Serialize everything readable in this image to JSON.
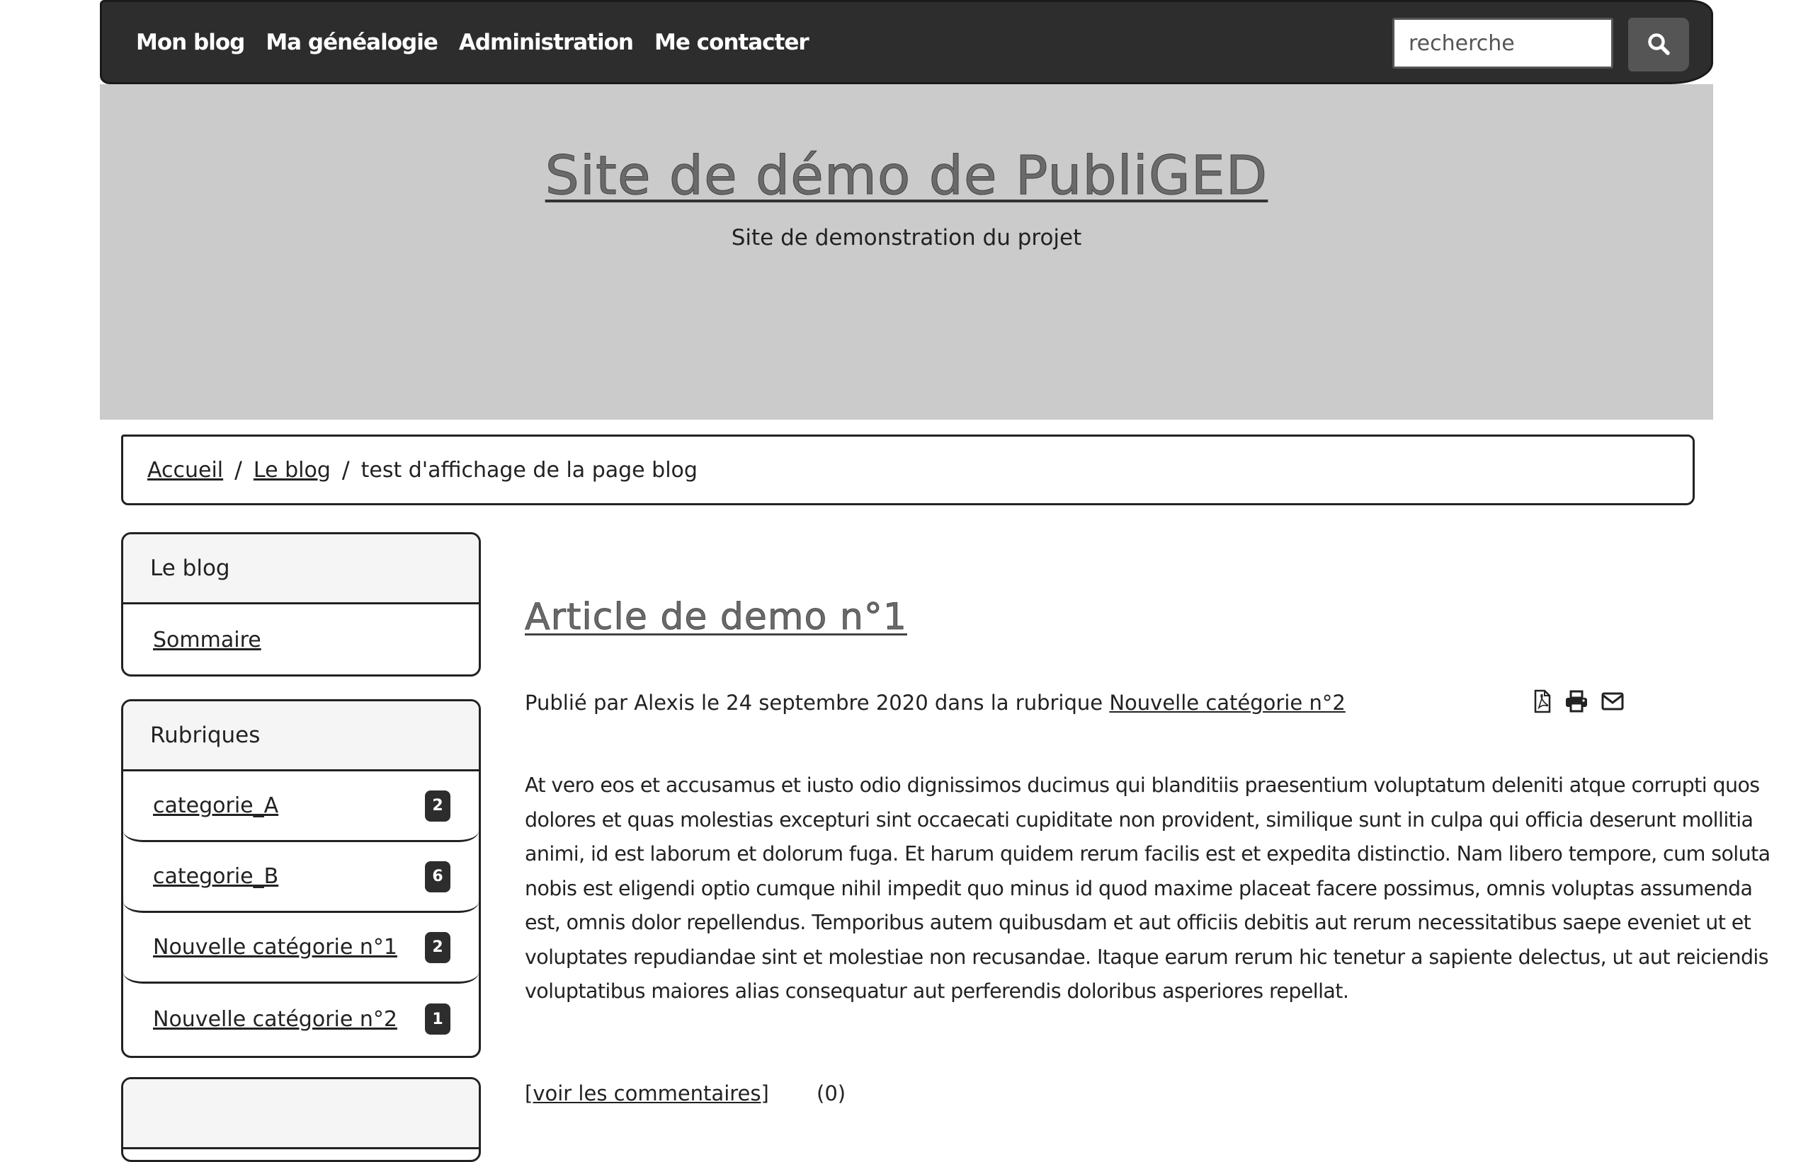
{
  "nav": {
    "items": [
      {
        "label": "Mon blog"
      },
      {
        "label": "Ma généalogie"
      },
      {
        "label": "Administration"
      },
      {
        "label": "Me contacter"
      }
    ],
    "search_placeholder": "recherche",
    "search_icon": "magnifier-icon"
  },
  "header": {
    "title": "Site de démo de PubliGED",
    "subtitle": "Site de demonstration du projet"
  },
  "breadcrumb": {
    "items": [
      "Accueil",
      "Le blog"
    ],
    "current": "test d'affichage de la page blog",
    "separator": "/"
  },
  "sidebar": {
    "blog_panel": {
      "heading": "Le blog",
      "items": [
        {
          "label": "Sommaire"
        }
      ]
    },
    "categories_panel": {
      "heading": "Rubriques",
      "items": [
        {
          "label": "categorie_A",
          "count": "2"
        },
        {
          "label": "categorie_B",
          "count": "6"
        },
        {
          "label": "Nouvelle catégorie n°1",
          "count": "2"
        },
        {
          "label": "Nouvelle catégorie n°2",
          "count": "1"
        }
      ]
    }
  },
  "article": {
    "title": "Article de demo n°1",
    "meta_prefix": "Publié par Alexis le 24 septembre 2020 dans la rubrique",
    "meta_category": "Nouvelle catégorie n°2",
    "icons": [
      "pdf-icon",
      "print-icon",
      "email-icon"
    ],
    "body": "At vero eos et accusamus et iusto odio dignissimos ducimus qui blanditiis praesentium voluptatum deleniti atque corrupti quos dolores et quas molestias excepturi sint occaecati cupiditate non provident, similique sunt in culpa qui officia deserunt mollitia animi, id est laborum et dolorum fuga. Et harum quidem rerum facilis est et expedita distinctio. Nam libero tempore, cum soluta nobis est eligendi optio cumque nihil impedit quo minus id quod maxime placeat facere possimus, omnis voluptas assumenda est, omnis dolor repellendus. Temporibus autem quibusdam et aut officiis debitis aut rerum necessitatibus saepe eveniet ut et voluptates repudiandae sint et molestiae non recusandae. Itaque earum rerum hic tenetur a sapiente delectus, ut aut reiciendis voluptatibus maiores alias consequatur aut perferendis doloribus asperiores repellat.",
    "comments_link": "[voir les commentaires]",
    "comments_count": "(0)"
  },
  "colors": {
    "navbar": "#2d2d2d",
    "header": "#cbcbcb",
    "search_button": "#555555",
    "badge": "#2d2d2d"
  }
}
